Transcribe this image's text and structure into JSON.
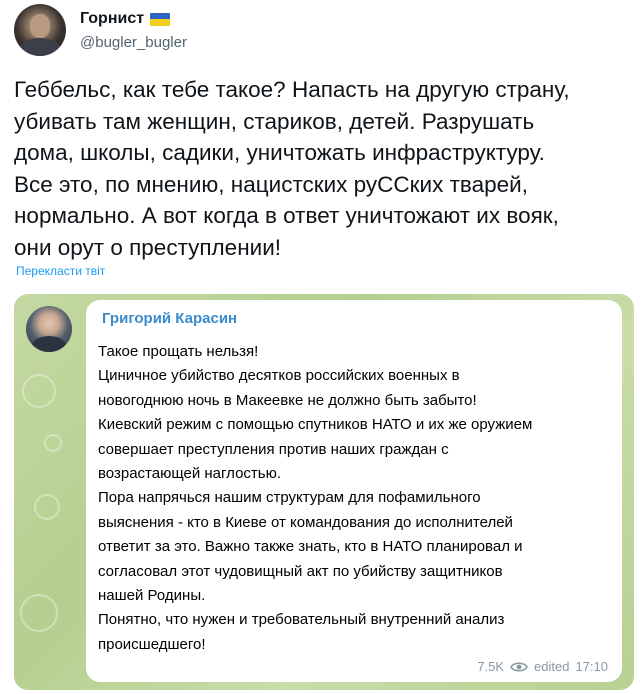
{
  "tweet": {
    "author_name": "Горнист",
    "author_handle": "@bugler_bugler",
    "text_lines": [
      "Геббельс, как тебе такое? Напасть на другую страну,",
      "убивать там женщин, стариков, детей. Разрушать",
      "дома, школы, садики, уничтожать инфраструктуру.",
      "Все это, по мнению, нацистских руССких тварей,",
      "нормально. А вот когда в ответ уничтожают их вояк,",
      "они орут о преступлении!"
    ],
    "translate_label": "Перекласти твіт"
  },
  "telegram": {
    "channel_name": "Григорий Карасин",
    "message_lines": [
      "Такое прощать нельзя!",
      "Циничное убийство десятков российских военных в",
      "новогоднюю ночь в Макеевке не должно быть забыто!",
      "Киевский режим с помощью спутников НАТО и их же оружием",
      "совершает преступления против наших граждан с",
      "возрастающей наглостью.",
      "Пора напрячься нашим структурам для пофамильного",
      "выяснения - кто в Киеве от командования до исполнителей",
      "ответит за это. Важно также знать, кто в НАТО планировал и",
      "согласовал этот чудовищный акт по убийству защитников",
      "нашей Родины.",
      "Понятно, что нужен и требовательный внутренний анализ",
      "происшедшего!"
    ],
    "views": "7.5K",
    "edited_label": "edited",
    "time": "17:10"
  },
  "icons": [
    "ukraine-flag-icon",
    "eye-icon",
    "more-icon"
  ],
  "colors": {
    "channel_name": "#3a8bcd",
    "link": "#1d9bf0",
    "handle": "#536471",
    "telegram_bg": "#c4d9a3"
  }
}
